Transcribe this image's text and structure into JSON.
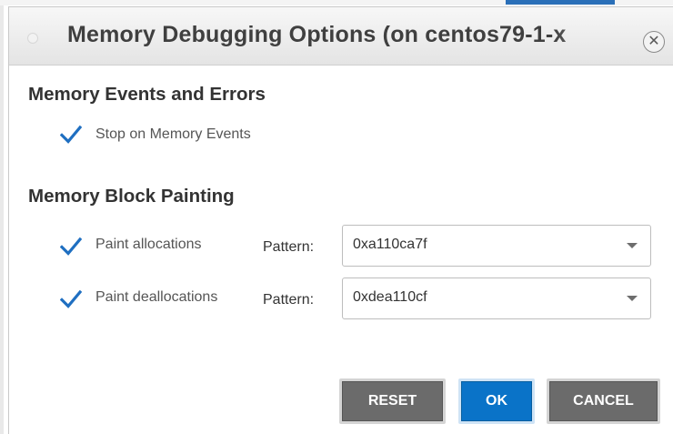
{
  "dialog": {
    "title": "Memory Debugging Options (on centos79-1-x"
  },
  "memory_events": {
    "heading": "Memory Events and Errors",
    "stop_on_events": {
      "label": "Stop on Memory Events",
      "checked": true
    }
  },
  "block_painting": {
    "heading": "Memory Block Painting",
    "paint_allocations": {
      "label": "Paint allocations",
      "checked": true,
      "pattern_label": "Pattern:",
      "pattern_value": "0xa110ca7f"
    },
    "paint_deallocations": {
      "label": "Paint deallocations",
      "checked": true,
      "pattern_label": "Pattern:",
      "pattern_value": "0xdea110cf"
    }
  },
  "buttons": {
    "reset": "RESET",
    "ok": "OK",
    "cancel": "CANCEL"
  },
  "colors": {
    "accent": "#0a73c8",
    "check": "#1f6fc1",
    "button_gray": "#6b6b6b"
  },
  "icons": {
    "close": "close-icon",
    "checkbox": "checkmark-icon",
    "dropdown": "chevron-down-icon"
  }
}
